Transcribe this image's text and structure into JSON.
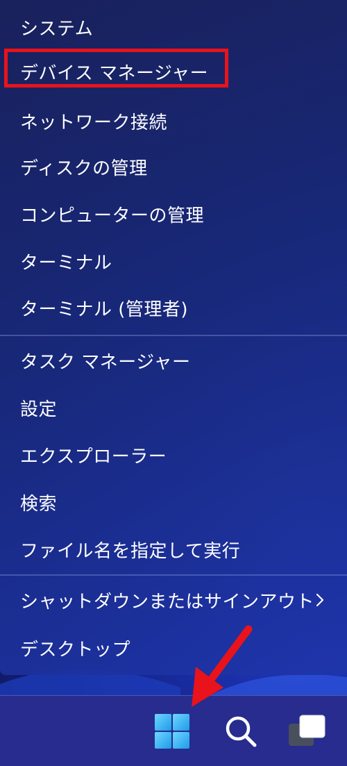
{
  "menu": {
    "items": [
      {
        "label": "システム"
      },
      {
        "label": "デバイス マネージャー"
      },
      {
        "label": "ネットワーク接続"
      },
      {
        "label": "ディスクの管理"
      },
      {
        "label": "コンピューターの管理"
      },
      {
        "label": "ターミナル"
      },
      {
        "label": "ターミナル (管理者)"
      },
      {
        "label": "タスク マネージャー"
      },
      {
        "label": "設定"
      },
      {
        "label": "エクスプローラー"
      },
      {
        "label": "検索"
      },
      {
        "label": "ファイル名を指定して実行"
      },
      {
        "label": "シャットダウンまたはサインアウト",
        "icon": "chevron-right-icon"
      },
      {
        "label": "デスクトップ"
      }
    ],
    "highlighted_item": "デバイス マネージャー"
  },
  "taskbar": {
    "icons": [
      "windows-start-icon",
      "search-icon",
      "task-view-icon"
    ]
  },
  "annotations": {
    "highlight_color": "#e8131b",
    "arrow_color": "#e8131b"
  }
}
